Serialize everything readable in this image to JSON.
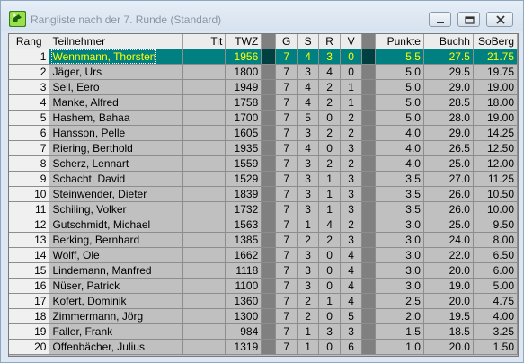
{
  "window": {
    "title": "Rangliste nach der 7. Runde (Standard)",
    "app_icon": "swiss-chess-icon",
    "controls": [
      "minimize-icon",
      "maximize-icon",
      "close-icon"
    ]
  },
  "colors": {
    "selected_bg": "#008080",
    "selected_text": "#ffff00",
    "cell_bg": "#c0c0c0",
    "separator": "#808080"
  },
  "table": {
    "headers": {
      "rank": "Rang",
      "name": "Teilnehmer",
      "tit": "Tit",
      "twz": "TWZ",
      "g": "G",
      "s": "S",
      "r": "R",
      "v": "V",
      "points": "Punkte",
      "buchh": "Buchh",
      "soberg": "SoBerg"
    },
    "selected_rank": "1",
    "rows": [
      {
        "rank": "1",
        "name": "Wennmann, Thorsten",
        "tit": "",
        "twz": "1956",
        "g": "7",
        "s": "4",
        "r": "3",
        "v": "0",
        "points": "5.5",
        "buchh": "27.5",
        "soberg": "21.75"
      },
      {
        "rank": "2",
        "name": "Jäger, Urs",
        "tit": "",
        "twz": "1800",
        "g": "7",
        "s": "3",
        "r": "4",
        "v": "0",
        "points": "5.0",
        "buchh": "29.5",
        "soberg": "19.75"
      },
      {
        "rank": "3",
        "name": "Sell, Eero",
        "tit": "",
        "twz": "1949",
        "g": "7",
        "s": "4",
        "r": "2",
        "v": "1",
        "points": "5.0",
        "buchh": "29.0",
        "soberg": "19.00"
      },
      {
        "rank": "4",
        "name": "Manke, Alfred",
        "tit": "",
        "twz": "1758",
        "g": "7",
        "s": "4",
        "r": "2",
        "v": "1",
        "points": "5.0",
        "buchh": "28.5",
        "soberg": "18.00"
      },
      {
        "rank": "5",
        "name": "Hashem, Bahaa",
        "tit": "",
        "twz": "1700",
        "g": "7",
        "s": "5",
        "r": "0",
        "v": "2",
        "points": "5.0",
        "buchh": "28.0",
        "soberg": "19.00"
      },
      {
        "rank": "6",
        "name": "Hansson, Pelle",
        "tit": "",
        "twz": "1605",
        "g": "7",
        "s": "3",
        "r": "2",
        "v": "2",
        "points": "4.0",
        "buchh": "29.0",
        "soberg": "14.25"
      },
      {
        "rank": "7",
        "name": "Riering, Berthold",
        "tit": "",
        "twz": "1935",
        "g": "7",
        "s": "4",
        "r": "0",
        "v": "3",
        "points": "4.0",
        "buchh": "26.5",
        "soberg": "12.50"
      },
      {
        "rank": "8",
        "name": "Scherz, Lennart",
        "tit": "",
        "twz": "1559",
        "g": "7",
        "s": "3",
        "r": "2",
        "v": "2",
        "points": "4.0",
        "buchh": "25.0",
        "soberg": "12.00"
      },
      {
        "rank": "9",
        "name": "Schacht, David",
        "tit": "",
        "twz": "1529",
        "g": "7",
        "s": "3",
        "r": "1",
        "v": "3",
        "points": "3.5",
        "buchh": "27.0",
        "soberg": "11.25"
      },
      {
        "rank": "10",
        "name": "Steinwender, Dieter",
        "tit": "",
        "twz": "1839",
        "g": "7",
        "s": "3",
        "r": "1",
        "v": "3",
        "points": "3.5",
        "buchh": "26.0",
        "soberg": "10.50"
      },
      {
        "rank": "11",
        "name": "Schiling, Volker",
        "tit": "",
        "twz": "1732",
        "g": "7",
        "s": "3",
        "r": "1",
        "v": "3",
        "points": "3.5",
        "buchh": "26.0",
        "soberg": "10.00"
      },
      {
        "rank": "12",
        "name": "Gutschmidt, Michael",
        "tit": "",
        "twz": "1563",
        "g": "7",
        "s": "1",
        "r": "4",
        "v": "2",
        "points": "3.0",
        "buchh": "25.0",
        "soberg": "9.50"
      },
      {
        "rank": "13",
        "name": "Berking, Bernhard",
        "tit": "",
        "twz": "1385",
        "g": "7",
        "s": "2",
        "r": "2",
        "v": "3",
        "points": "3.0",
        "buchh": "24.0",
        "soberg": "8.00"
      },
      {
        "rank": "14",
        "name": "Wolff, Ole",
        "tit": "",
        "twz": "1662",
        "g": "7",
        "s": "3",
        "r": "0",
        "v": "4",
        "points": "3.0",
        "buchh": "22.0",
        "soberg": "6.50"
      },
      {
        "rank": "15",
        "name": "Lindemann, Manfred",
        "tit": "",
        "twz": "1118",
        "g": "7",
        "s": "3",
        "r": "0",
        "v": "4",
        "points": "3.0",
        "buchh": "20.0",
        "soberg": "6.00"
      },
      {
        "rank": "16",
        "name": "Nüser, Patrick",
        "tit": "",
        "twz": "1100",
        "g": "7",
        "s": "3",
        "r": "0",
        "v": "4",
        "points": "3.0",
        "buchh": "19.0",
        "soberg": "5.00"
      },
      {
        "rank": "17",
        "name": "Kofert, Dominik",
        "tit": "",
        "twz": "1360",
        "g": "7",
        "s": "2",
        "r": "1",
        "v": "4",
        "points": "2.5",
        "buchh": "20.0",
        "soberg": "4.75"
      },
      {
        "rank": "18",
        "name": "Zimmermann, Jörg",
        "tit": "",
        "twz": "1300",
        "g": "7",
        "s": "2",
        "r": "0",
        "v": "5",
        "points": "2.0",
        "buchh": "19.5",
        "soberg": "4.00"
      },
      {
        "rank": "19",
        "name": "Faller, Frank",
        "tit": "",
        "twz": "984",
        "g": "7",
        "s": "1",
        "r": "3",
        "v": "3",
        "points": "1.5",
        "buchh": "18.5",
        "soberg": "3.25"
      },
      {
        "rank": "20",
        "name": "Offenbächer, Julius",
        "tit": "",
        "twz": "1319",
        "g": "7",
        "s": "1",
        "r": "0",
        "v": "6",
        "points": "1.0",
        "buchh": "20.0",
        "soberg": "1.50"
      }
    ]
  }
}
